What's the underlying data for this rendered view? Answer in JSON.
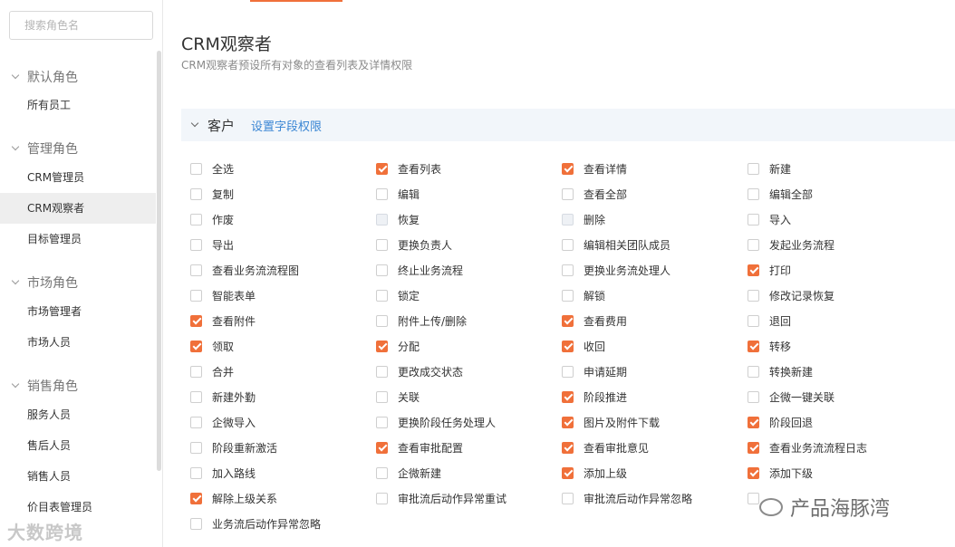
{
  "sidebar": {
    "search_placeholder": "搜索角色名",
    "groups": [
      {
        "title": "默认角色",
        "items": [
          "所有员工"
        ]
      },
      {
        "title": "管理角色",
        "items": [
          "CRM管理员",
          "CRM观察者",
          "目标管理员"
        ]
      },
      {
        "title": "市场角色",
        "items": [
          "市场管理者",
          "市场人员"
        ]
      },
      {
        "title": "销售角色",
        "items": [
          "服务人员",
          "售后人员",
          "销售人员",
          "价目表管理员"
        ]
      }
    ],
    "active_item": "CRM观察者"
  },
  "main": {
    "title": "CRM观察者",
    "subtitle": "CRM观察者预设所有对象的查看列表及详情权限",
    "section": {
      "title": "客户",
      "link": "设置字段权限"
    },
    "permissions": [
      {
        "label": "全选",
        "state": "unchecked"
      },
      {
        "label": "查看列表",
        "state": "checked"
      },
      {
        "label": "查看详情",
        "state": "checked"
      },
      {
        "label": "新建",
        "state": "unchecked"
      },
      {
        "label": "复制",
        "state": "unchecked"
      },
      {
        "label": "编辑",
        "state": "unchecked"
      },
      {
        "label": "查看全部",
        "state": "unchecked"
      },
      {
        "label": "编辑全部",
        "state": "unchecked"
      },
      {
        "label": "作废",
        "state": "unchecked"
      },
      {
        "label": "恢复",
        "state": "disabled"
      },
      {
        "label": "删除",
        "state": "disabled"
      },
      {
        "label": "导入",
        "state": "unchecked"
      },
      {
        "label": "导出",
        "state": "unchecked"
      },
      {
        "label": "更换负责人",
        "state": "unchecked"
      },
      {
        "label": "编辑相关团队成员",
        "state": "unchecked"
      },
      {
        "label": "发起业务流程",
        "state": "unchecked"
      },
      {
        "label": "查看业务流流程图",
        "state": "unchecked"
      },
      {
        "label": "终止业务流程",
        "state": "unchecked"
      },
      {
        "label": "更换业务流处理人",
        "state": "unchecked"
      },
      {
        "label": "打印",
        "state": "checked"
      },
      {
        "label": "智能表单",
        "state": "unchecked"
      },
      {
        "label": "锁定",
        "state": "unchecked"
      },
      {
        "label": "解锁",
        "state": "unchecked"
      },
      {
        "label": "修改记录恢复",
        "state": "unchecked"
      },
      {
        "label": "查看附件",
        "state": "checked"
      },
      {
        "label": "附件上传/删除",
        "state": "unchecked"
      },
      {
        "label": "查看费用",
        "state": "checked"
      },
      {
        "label": "退回",
        "state": "unchecked"
      },
      {
        "label": "领取",
        "state": "checked"
      },
      {
        "label": "分配",
        "state": "checked"
      },
      {
        "label": "收回",
        "state": "checked"
      },
      {
        "label": "转移",
        "state": "checked"
      },
      {
        "label": "合并",
        "state": "unchecked"
      },
      {
        "label": "更改成交状态",
        "state": "unchecked"
      },
      {
        "label": "申请延期",
        "state": "unchecked"
      },
      {
        "label": "转换新建",
        "state": "unchecked"
      },
      {
        "label": "新建外勤",
        "state": "unchecked"
      },
      {
        "label": "关联",
        "state": "unchecked"
      },
      {
        "label": "阶段推进",
        "state": "checked"
      },
      {
        "label": "企微一键关联",
        "state": "unchecked"
      },
      {
        "label": "企微导入",
        "state": "unchecked"
      },
      {
        "label": "更换阶段任务处理人",
        "state": "unchecked"
      },
      {
        "label": "图片及附件下载",
        "state": "checked"
      },
      {
        "label": "阶段回退",
        "state": "checked"
      },
      {
        "label": "阶段重新激活",
        "state": "unchecked"
      },
      {
        "label": "查看审批配置",
        "state": "checked"
      },
      {
        "label": "查看审批意见",
        "state": "checked"
      },
      {
        "label": "查看业务流流程日志",
        "state": "checked"
      },
      {
        "label": "加入路线",
        "state": "unchecked"
      },
      {
        "label": "企微新建",
        "state": "unchecked"
      },
      {
        "label": "添加上级",
        "state": "checked"
      },
      {
        "label": "添加下级",
        "state": "checked"
      },
      {
        "label": "解除上级关系",
        "state": "checked"
      },
      {
        "label": "审批流后动作异常重试",
        "state": "unchecked"
      },
      {
        "label": "审批流后动作异常忽略",
        "state": "unchecked"
      },
      {
        "label": "",
        "state": "unchecked"
      },
      {
        "label": "业务流后动作异常忽略",
        "state": "unchecked"
      }
    ]
  },
  "watermarks": {
    "left": "大数跨境",
    "right": "产品海豚湾"
  },
  "colors": {
    "accent": "#f0703a",
    "link": "#3a86d4",
    "section_bg": "#f2f6fa"
  }
}
